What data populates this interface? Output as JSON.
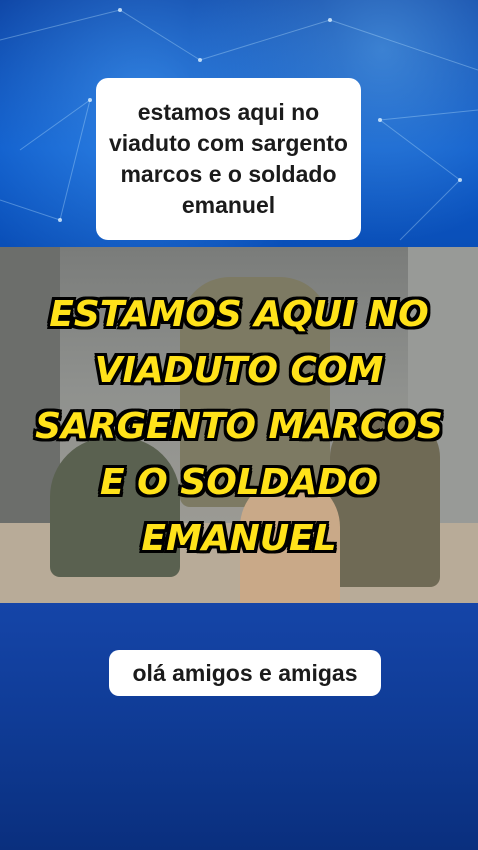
{
  "captions": {
    "top": "estamos aqui no viaduto com sargento marcos e o soldado emanuel",
    "overlay": "ESTAMOS AQUI NO VIADUTO COM SARGENTO MARCOS E O SOLDADO EMANUEL",
    "bottom": "olá amigos e amigas"
  },
  "colors": {
    "overlay_text": "#ffe21a",
    "caption_bg": "#ffffff",
    "background_blue": "#0a2a8a"
  }
}
